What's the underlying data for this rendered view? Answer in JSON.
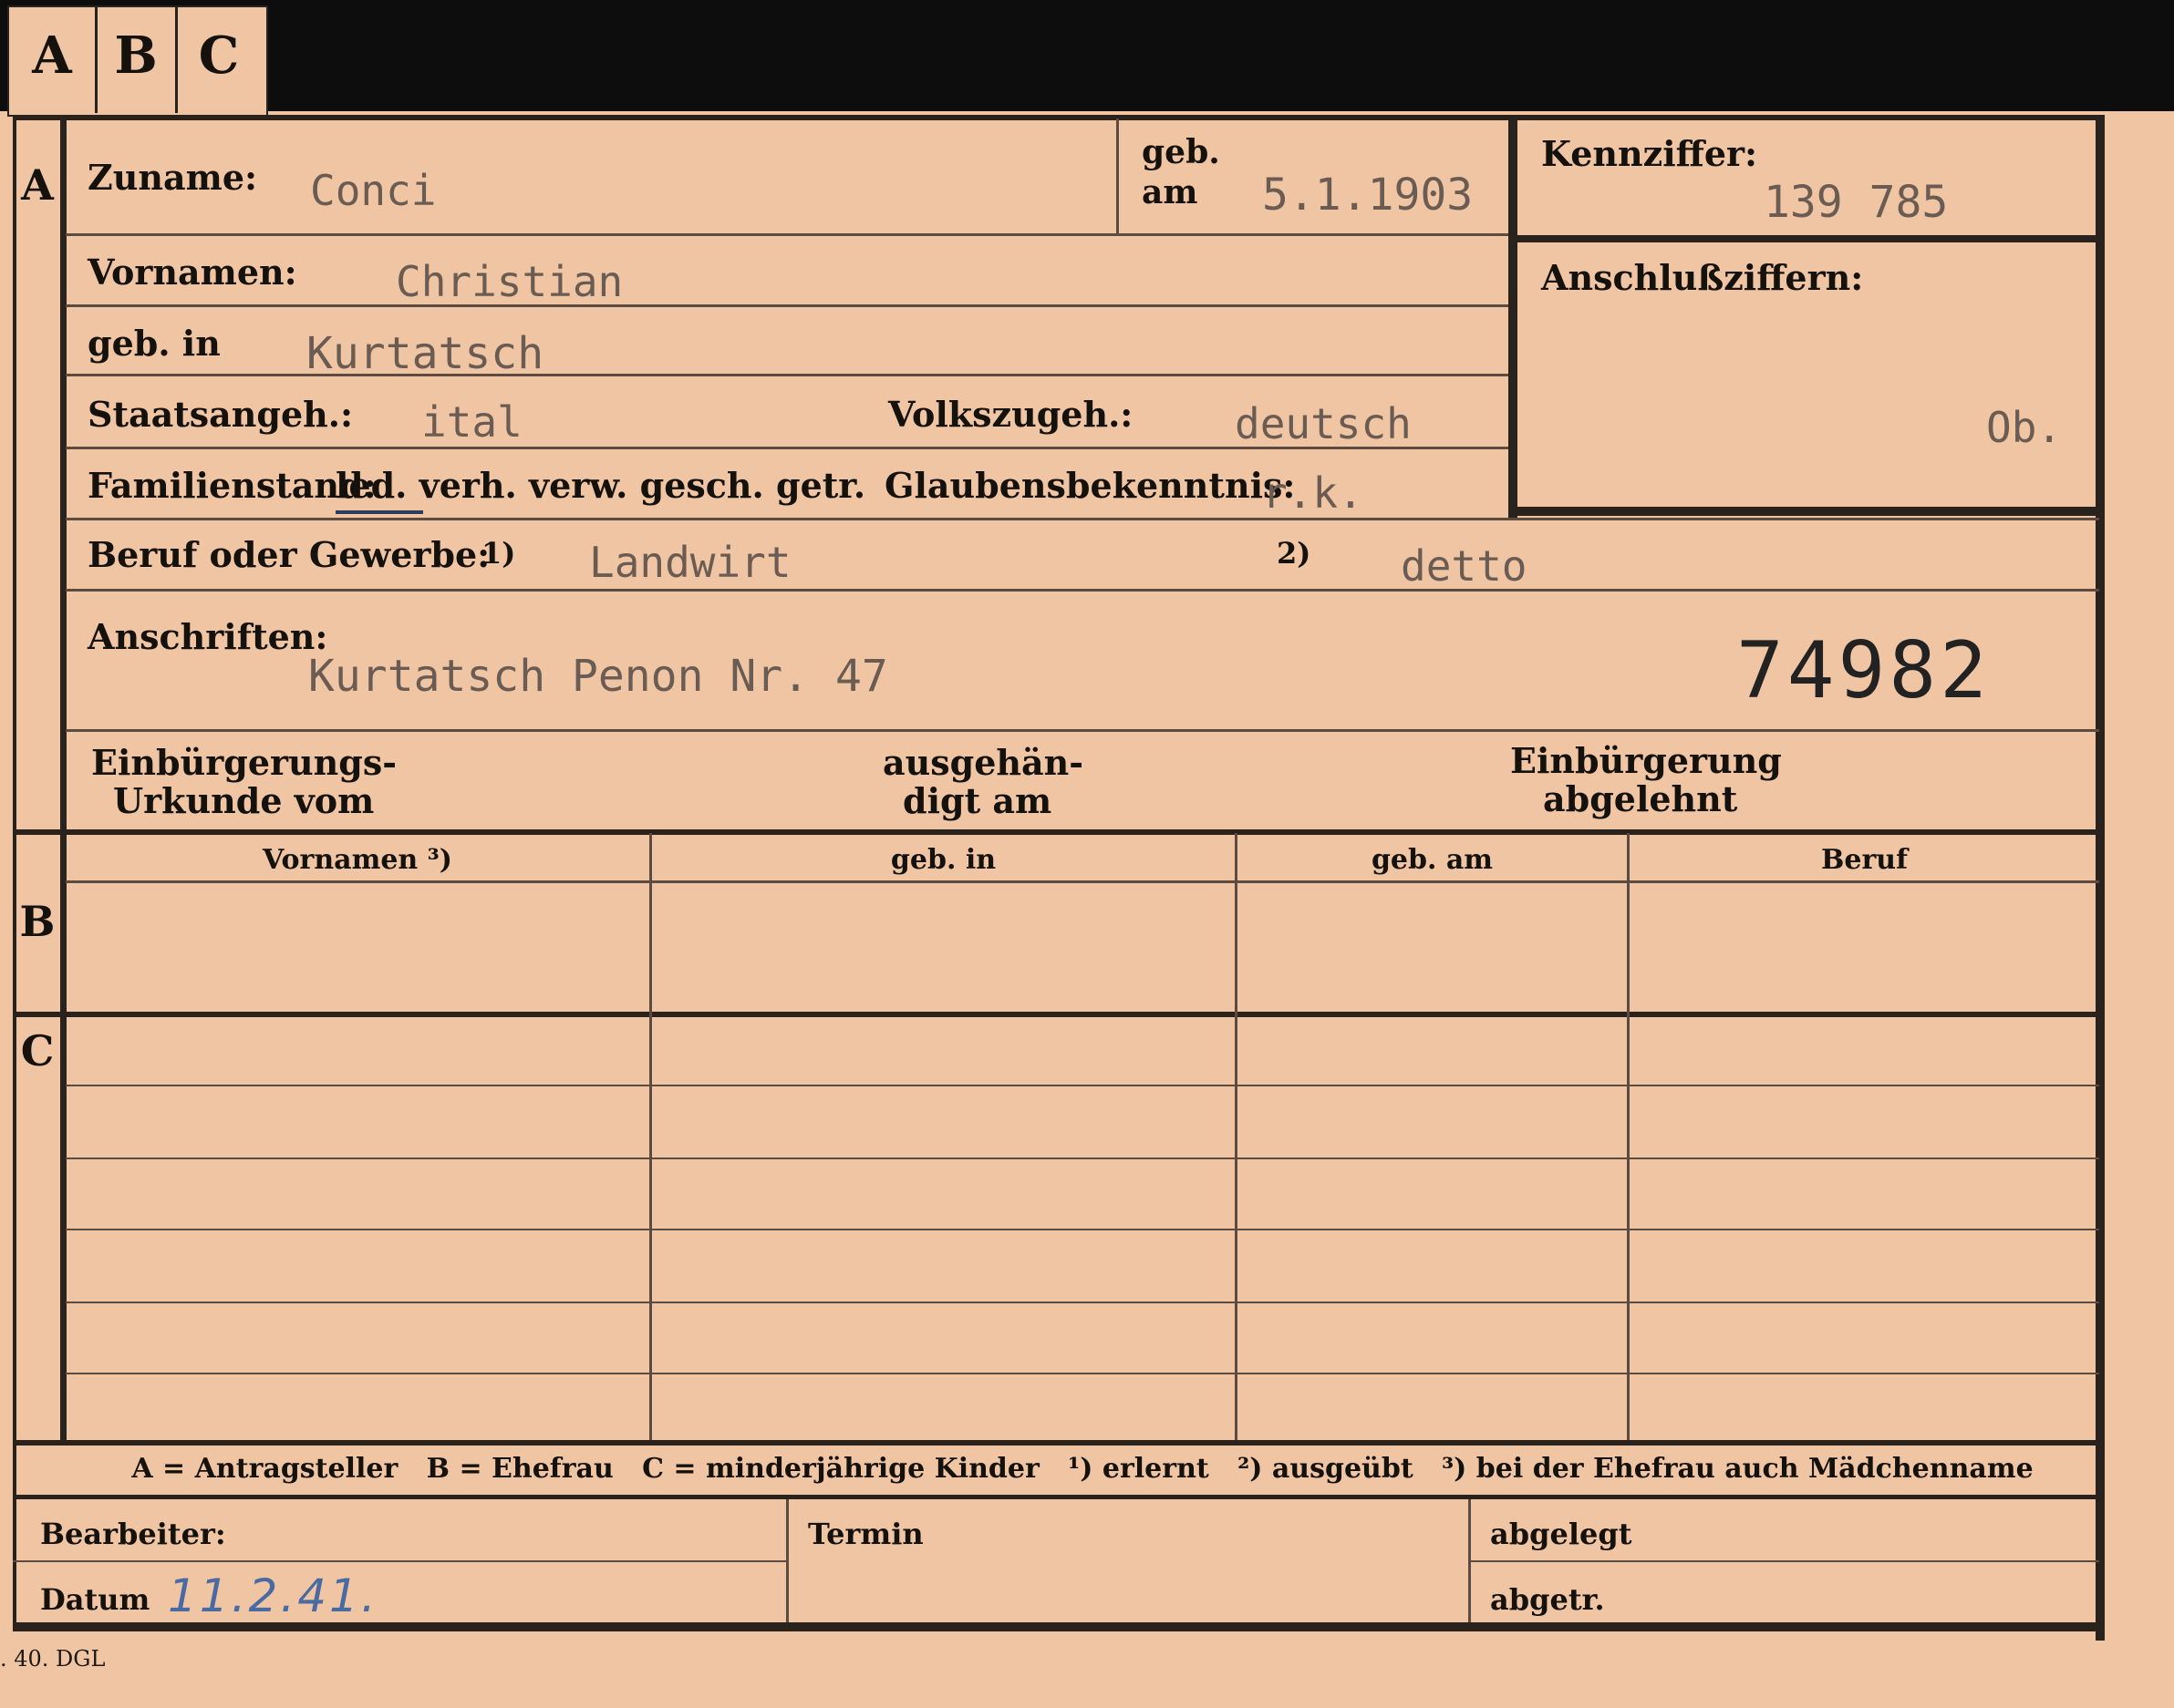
{
  "tabs": [
    "A",
    "B",
    "C"
  ],
  "section_letters": {
    "a": "A",
    "b": "B",
    "c": "C"
  },
  "fields": {
    "zuname_label": "Zuname:",
    "zuname_value": "Conci",
    "geb_label": "geb.",
    "am_label": "am",
    "birth_date": "5.1.1903",
    "kennziffer_label": "Kennziffer:",
    "kennziffer_value": "139 785",
    "vornamen_label": "Vornamen:",
    "vornamen_value": "Christian",
    "anschluss_label": "Anschlußziffern:",
    "anschluss_value": "Ob.",
    "gebin_label": "geb. in",
    "gebin_value": "Kurtatsch",
    "staats_label": "Staatsangeh.:",
    "staats_value": "ital",
    "volks_label": "Volkszugeh.:",
    "volks_value": "deutsch",
    "familien_label": "Familienstand:",
    "familien_options": "led. verh. verw. gesch. getr.",
    "glaubens_label": "Glaubensbekenntnis:",
    "glaubens_value": "r.k.",
    "beruf_label": "Beruf oder Gewerbe:",
    "beruf_mark1": "1)",
    "beruf_value1": "Landwirt",
    "beruf_mark2": "2)",
    "beruf_value2": "detto",
    "anschriften_label": "Anschriften:",
    "anschriften_value": "Kurtatsch Penon Nr. 47",
    "stamp_number": "74982",
    "einb_urkunde_l1": "Einbürgerungs-",
    "einb_urkunde_l2": "Urkunde vom",
    "ausgehaend_l1": "ausgehän-",
    "ausgehaend_l2": "digt am",
    "einb_abgelehnt_l1": "Einbürgerung",
    "einb_abgelehnt_l2": "abgelehnt"
  },
  "table": {
    "headers": [
      "Vornamen ³)",
      "geb. in",
      "geb. am",
      "Beruf"
    ]
  },
  "legend": "A = Antragsteller   B = Ehefrau   C = minderjährige Kinder   ¹) erlernt   ²) ausgeübt   ³) bei der Ehefrau auch Mädchenname",
  "footer": {
    "bearbeiter_label": "Bearbeiter:",
    "datum_label": "Datum",
    "datum_value": "11.2.41.",
    "termin_label": "Termin",
    "abgelegt_label": "abgelegt",
    "abgetr_label": "abgetr.",
    "print_code": ". 40. DGL"
  }
}
